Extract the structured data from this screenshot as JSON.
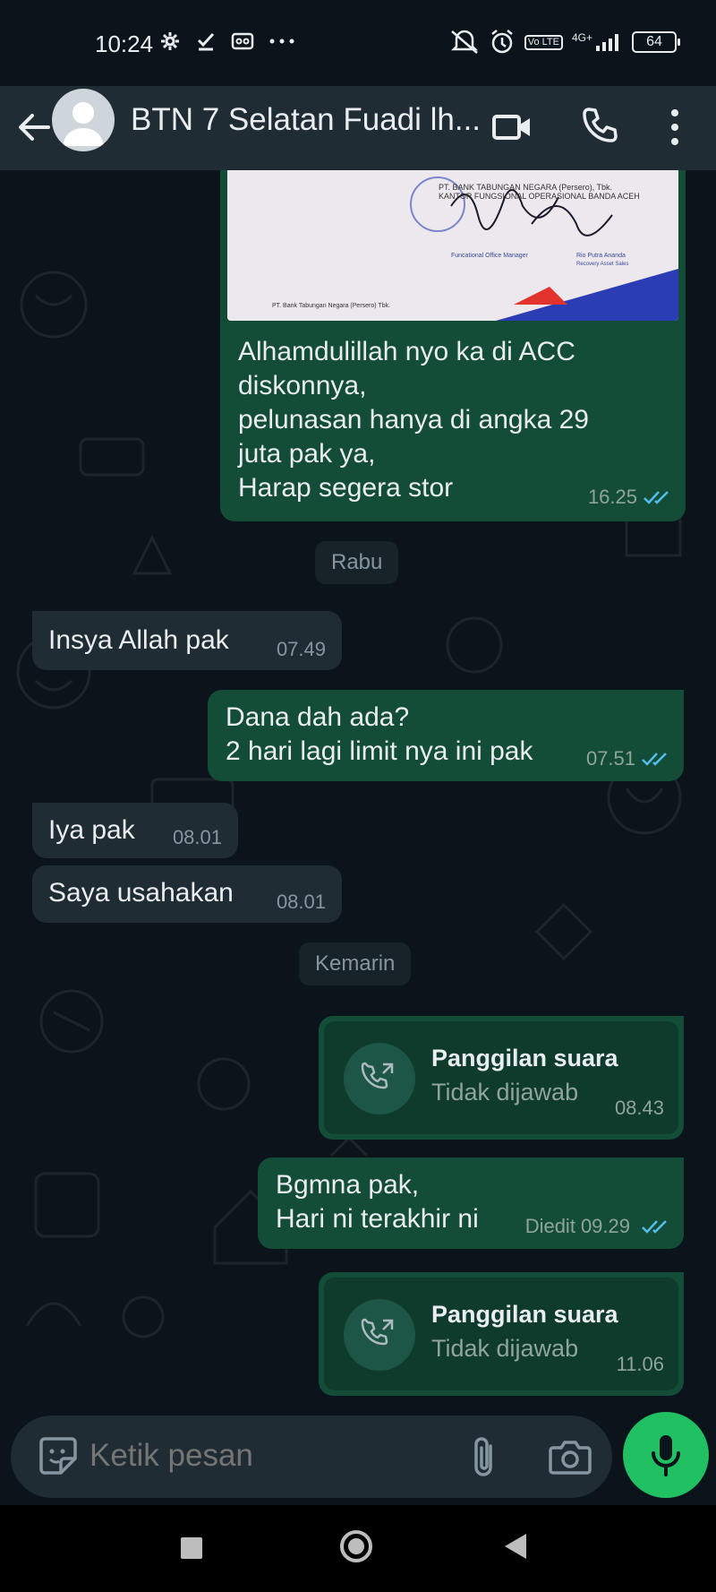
{
  "status_bar": {
    "time": "10:24",
    "left_icons": [
      "settings-icon",
      "check-icon",
      "voicemail-icon",
      "more-dots-icon"
    ],
    "right_icons": [
      "mute-icon",
      "alarm-icon",
      "volte-icon",
      "signal-4g-icon"
    ],
    "network": "4G+",
    "volte": "Vo LTE",
    "battery": "64"
  },
  "header": {
    "contact_name": "BTN 7 Selatan Fuadi lh..."
  },
  "messages": [
    {
      "direction": "out",
      "has_image": true,
      "image_lines": [
        "PT. BANK TABUNGAN NEGARA (Persero), Tbk.",
        "KANTOR FUNGSIONAL OPERASIONAL BANDA ACEH",
        "Funcational Office Manager",
        "Rio Putra Ananda",
        "Recovery Asset Sales",
        "PT. Bank Tabungan Negara (Persero) Tbk."
      ],
      "lines": [
        "Alhamdulillah nyo ka di ACC",
        "diskonnya,",
        "pelunasan hanya di angka 29",
        "juta pak ya,",
        "Harap segera stor"
      ],
      "time": "16.25",
      "read": true
    },
    {
      "type": "date",
      "label": "Rabu"
    },
    {
      "direction": "in",
      "lines": [
        "Insya Allah pak"
      ],
      "time": "07.49"
    },
    {
      "direction": "out",
      "lines": [
        "Dana dah ada?",
        "2 hari lagi limit nya ini pak"
      ],
      "time": "07.51",
      "read": true
    },
    {
      "direction": "in",
      "lines": [
        "Iya pak"
      ],
      "time": "08.01"
    },
    {
      "direction": "in",
      "lines": [
        "Saya usahakan"
      ],
      "time": "08.01"
    },
    {
      "type": "date",
      "label": "Kemarin"
    },
    {
      "direction": "out",
      "type": "call",
      "title": "Panggilan suara",
      "subtitle": "Tidak dijawab",
      "time": "08.43"
    },
    {
      "direction": "out",
      "lines": [
        "Bgmna pak,",
        "Hari ni terakhir ni"
      ],
      "edited": "Diedit",
      "time": "09.29",
      "read": true
    },
    {
      "direction": "out",
      "type": "call",
      "title": "Panggilan suara",
      "subtitle": "Tidak dijawab",
      "time": "11.06"
    }
  ],
  "composer": {
    "placeholder": "Ketik pesan"
  },
  "colors": {
    "background": "#0b141a",
    "header": "#1f2c34",
    "outgoing_bubble": "#144d37",
    "incoming_bubble": "#202c33",
    "read_ticks": "#53bdeb",
    "mic_button": "#21c063"
  }
}
